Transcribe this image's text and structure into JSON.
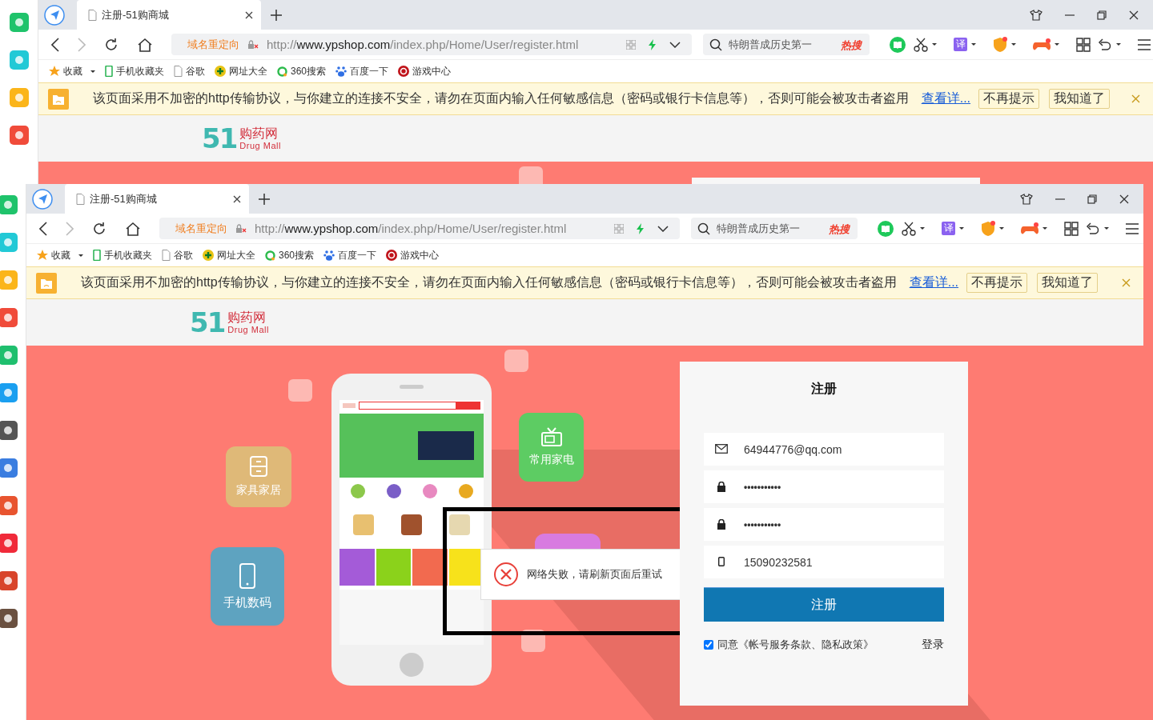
{
  "outer": {
    "tab": {
      "title": "注册-51购商城",
      "selected": true
    },
    "address": {
      "redirect": "域名重定向",
      "url_prefix": "http://",
      "url_host": "www.ypshop.com",
      "url_path": "/index.php/Home/User/register.html"
    },
    "search": {
      "placeholder": "特朗普成历史第一",
      "hot": "热搜"
    },
    "translate_label": "译",
    "bookmarks": [
      {
        "kind": "star",
        "label": "收藏"
      },
      {
        "kind": "phone",
        "label": "手机收藏夹"
      },
      {
        "kind": "doc",
        "label": "谷歌"
      },
      {
        "kind": "nav",
        "label": "网址大全"
      },
      {
        "kind": "search360",
        "label": "360搜索"
      },
      {
        "kind": "baidu",
        "label": "百度一下"
      },
      {
        "kind": "game",
        "label": "游戏中心"
      }
    ],
    "warning": {
      "text": "该页面采用不加密的http传输协议，与你建立的连接不安全，请勿在页面内输入任何敏感信息（密码或银行卡信息等），否则可能会被攻击者盗用",
      "link": "查看详...",
      "buttons": [
        "不再提示",
        "我知道了"
      ]
    },
    "logo": {
      "mark": "51",
      "name": "购药网",
      "subtitle": "Drug Mall"
    }
  },
  "inner": {
    "tab": {
      "title": "注册-51购商城",
      "selected": true
    },
    "address": {
      "redirect": "域名重定向",
      "url_prefix": "http://",
      "url_host": "www.ypshop.com",
      "url_path": "/index.php/Home/User/register.html"
    },
    "search": {
      "placeholder": "特朗普成历史第一",
      "hot": "热搜"
    },
    "translate_label": "译",
    "bookmarks": [
      {
        "kind": "star",
        "label": "收藏"
      },
      {
        "kind": "phone",
        "label": "手机收藏夹"
      },
      {
        "kind": "doc",
        "label": "谷歌"
      },
      {
        "kind": "nav",
        "label": "网址大全"
      },
      {
        "kind": "search360",
        "label": "360搜索"
      },
      {
        "kind": "baidu",
        "label": "百度一下"
      },
      {
        "kind": "game",
        "label": "游戏中心"
      }
    ],
    "warning": {
      "text": "该页面采用不加密的http传输协议，与你建立的连接不安全，请勿在页面内输入任何敏感信息（密码或银行卡信息等），否则可能会被攻击者盗用",
      "link": "查看详...",
      "buttons": [
        "不再提示",
        "我知道了"
      ]
    },
    "logo": {
      "mark": "51",
      "name": "购药网",
      "subtitle": "Drug Mall"
    },
    "page": {
      "categories": [
        {
          "kind": "furniture",
          "label": "家具家居",
          "color": "#dfb978"
        },
        {
          "kind": "appliance",
          "label": "常用家电",
          "color": "#5dcc63"
        },
        {
          "kind": "phone",
          "label": "手机数码",
          "color": "#5ea3c0"
        }
      ],
      "toast": {
        "message": "网络失败，请刷新页面后重试"
      },
      "form": {
        "title": "注册",
        "fields": [
          {
            "kind": "email",
            "value": "64944776@qq.com"
          },
          {
            "kind": "password",
            "value": "•••••••••••"
          },
          {
            "kind": "password",
            "value": "•••••••••••"
          },
          {
            "kind": "phone",
            "value": "15090232581"
          }
        ],
        "submit": "注册",
        "agree": {
          "checked": true,
          "text": "同意《帐号服务条款、隐私政策》"
        },
        "login": "登录"
      }
    }
  }
}
